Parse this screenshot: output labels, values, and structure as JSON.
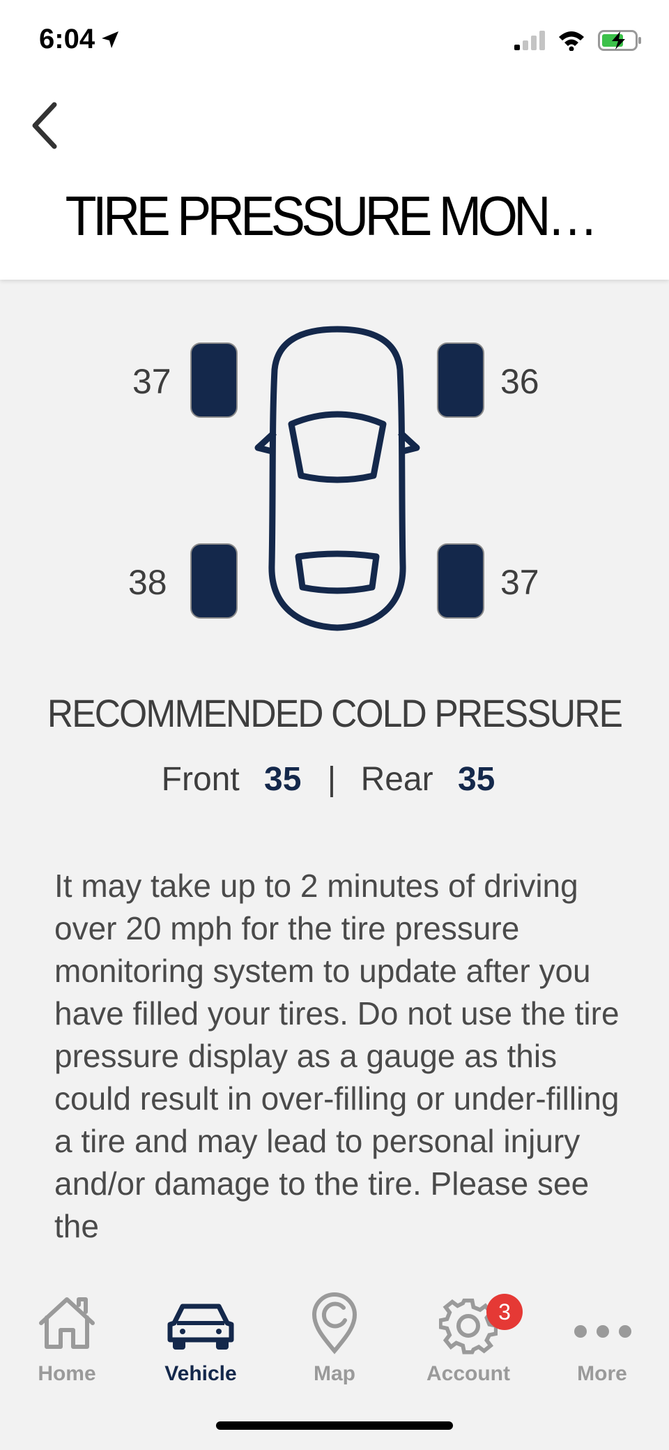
{
  "status_bar": {
    "time": "6:04"
  },
  "header": {
    "title": "TIRE PRESSURE MONITORI..."
  },
  "tires": {
    "front_left": "37",
    "front_right": "36",
    "rear_left": "38",
    "rear_right": "37"
  },
  "recommended": {
    "heading": "RECOMMENDED COLD PRESSURE",
    "front_label": "Front",
    "front_value": "35",
    "separator": "|",
    "rear_label": "Rear",
    "rear_value": "35"
  },
  "info_text": "It may take up to 2 minutes of driving over 20 mph for the tire pressure monitoring system to update after you have filled your tires. Do not use the tire pressure display as a gauge as this could result in over-filling or under-filling a tire and may lead to personal injury and/or damage to the tire. Please see the",
  "tabbar": {
    "tabs": [
      {
        "label": "Home",
        "icon": "home-icon"
      },
      {
        "label": "Vehicle",
        "icon": "car-icon"
      },
      {
        "label": "Map",
        "icon": "map-pin-icon"
      },
      {
        "label": "Account",
        "icon": "gear-icon",
        "badge": "3"
      },
      {
        "label": "More",
        "icon": "more-icon"
      }
    ],
    "active": "Vehicle"
  },
  "colors": {
    "brand_navy": "#14284b",
    "badge_red": "#e53935",
    "inactive_gray": "#9a9a9a"
  }
}
